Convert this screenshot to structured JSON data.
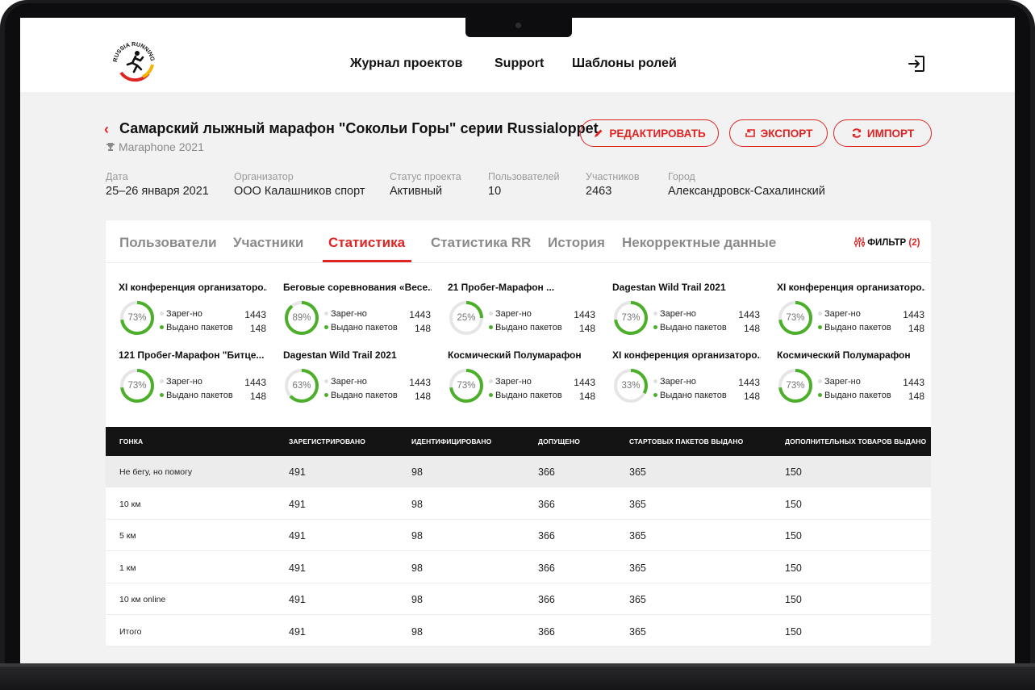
{
  "header": {
    "logo_text": "RUSSIA RUNNING",
    "nav": [
      "Журнал проектов",
      "Support",
      "Шаблоны ролей"
    ]
  },
  "project": {
    "title": "Самарский лыжный марафон \"Сокольи Горы\" серии Russialoppet",
    "subtitle": "Maraphone 2021",
    "buttons": {
      "edit": "РЕДАКТИРОВАТЬ",
      "export": "ЭКСПОРТ",
      "import": "ИМПОРТ"
    },
    "meta": [
      {
        "label": "Дата",
        "value": "25–26 января 2021"
      },
      {
        "label": "Организатор",
        "value": "ООО Калашников спорт"
      },
      {
        "label": "Статус проекта",
        "value": "Активный"
      },
      {
        "label": "Пользователей",
        "value": "10"
      },
      {
        "label": "Участников",
        "value": "2463"
      },
      {
        "label": "Город",
        "value": "Александровск-Сахалинский"
      }
    ]
  },
  "tabs": [
    "Пользователи",
    "Участники",
    "Статистика",
    "Статистика RR",
    "История",
    "Некорректные данные"
  ],
  "active_tab": "Статистика",
  "filter": {
    "label": "ФИЛЬТР",
    "count": "(2)"
  },
  "stats_labels": {
    "registered": "Зарег-но",
    "issued": "Выдано пакетов"
  },
  "stats": [
    {
      "title": "XI конференция организаторо...",
      "percent": "73%",
      "fraction": 0.73,
      "registered": "1443",
      "issued": "148"
    },
    {
      "title": "Беговые соревнования «Весе...",
      "percent": "89%",
      "fraction": 0.89,
      "registered": "1443",
      "issued": "148"
    },
    {
      "title": "21 Пробег-Марафон ...",
      "percent": "25%",
      "fraction": 0.25,
      "registered": "1443",
      "issued": "148"
    },
    {
      "title": "Dagestan Wild Trail 2021",
      "percent": "73%",
      "fraction": 0.73,
      "registered": "1443",
      "issued": "148"
    },
    {
      "title": "XI конференция организаторо...",
      "percent": "73%",
      "fraction": 0.73,
      "registered": "1443",
      "issued": "148"
    },
    {
      "title": "121 Пробег-Марафон \"Битце...",
      "percent": "73%",
      "fraction": 0.73,
      "registered": "1443",
      "issued": "148"
    },
    {
      "title": "Dagestan Wild Trail 2021",
      "percent": "63%",
      "fraction": 0.63,
      "registered": "1443",
      "issued": "148"
    },
    {
      "title": "Космический Полумарафон",
      "percent": "73%",
      "fraction": 0.73,
      "registered": "1443",
      "issued": "148"
    },
    {
      "title": "XI конференция организаторо...",
      "percent": "33%",
      "fraction": 0.33,
      "registered": "1443",
      "issued": "148"
    },
    {
      "title": "Космический Полумарафон",
      "percent": "73%",
      "fraction": 0.73,
      "registered": "1443",
      "issued": "148"
    }
  ],
  "table": {
    "columns": [
      "ГОНКА",
      "ЗАРЕГИСТРИРОВАНО",
      "ИДЕНТИФИЦИРОВАНО",
      "ДОПУЩЕНО",
      "СТАРТОВЫХ ПАКЕТОВ ВЫДАНО",
      "ДОПОЛНИТЕЛЬНЫХ ТОВАРОВ ВЫДАНО"
    ],
    "rows": [
      [
        "Не бегу, но помогу",
        "491",
        "98",
        "366",
        "365",
        "150"
      ],
      [
        "10 км",
        "491",
        "98",
        "366",
        "365",
        "150"
      ],
      [
        "5 км",
        "491",
        "98",
        "366",
        "365",
        "150"
      ],
      [
        "1 км",
        "491",
        "98",
        "366",
        "365",
        "150"
      ],
      [
        "10 км online",
        "491",
        "98",
        "366",
        "365",
        "150"
      ],
      [
        "Итого",
        "491",
        "98",
        "366",
        "365",
        "150"
      ]
    ]
  },
  "colors": {
    "accent": "#e02424",
    "ring": "#4caf2a",
    "ring_track": "#e6e6e6",
    "table_head": "#141414"
  }
}
